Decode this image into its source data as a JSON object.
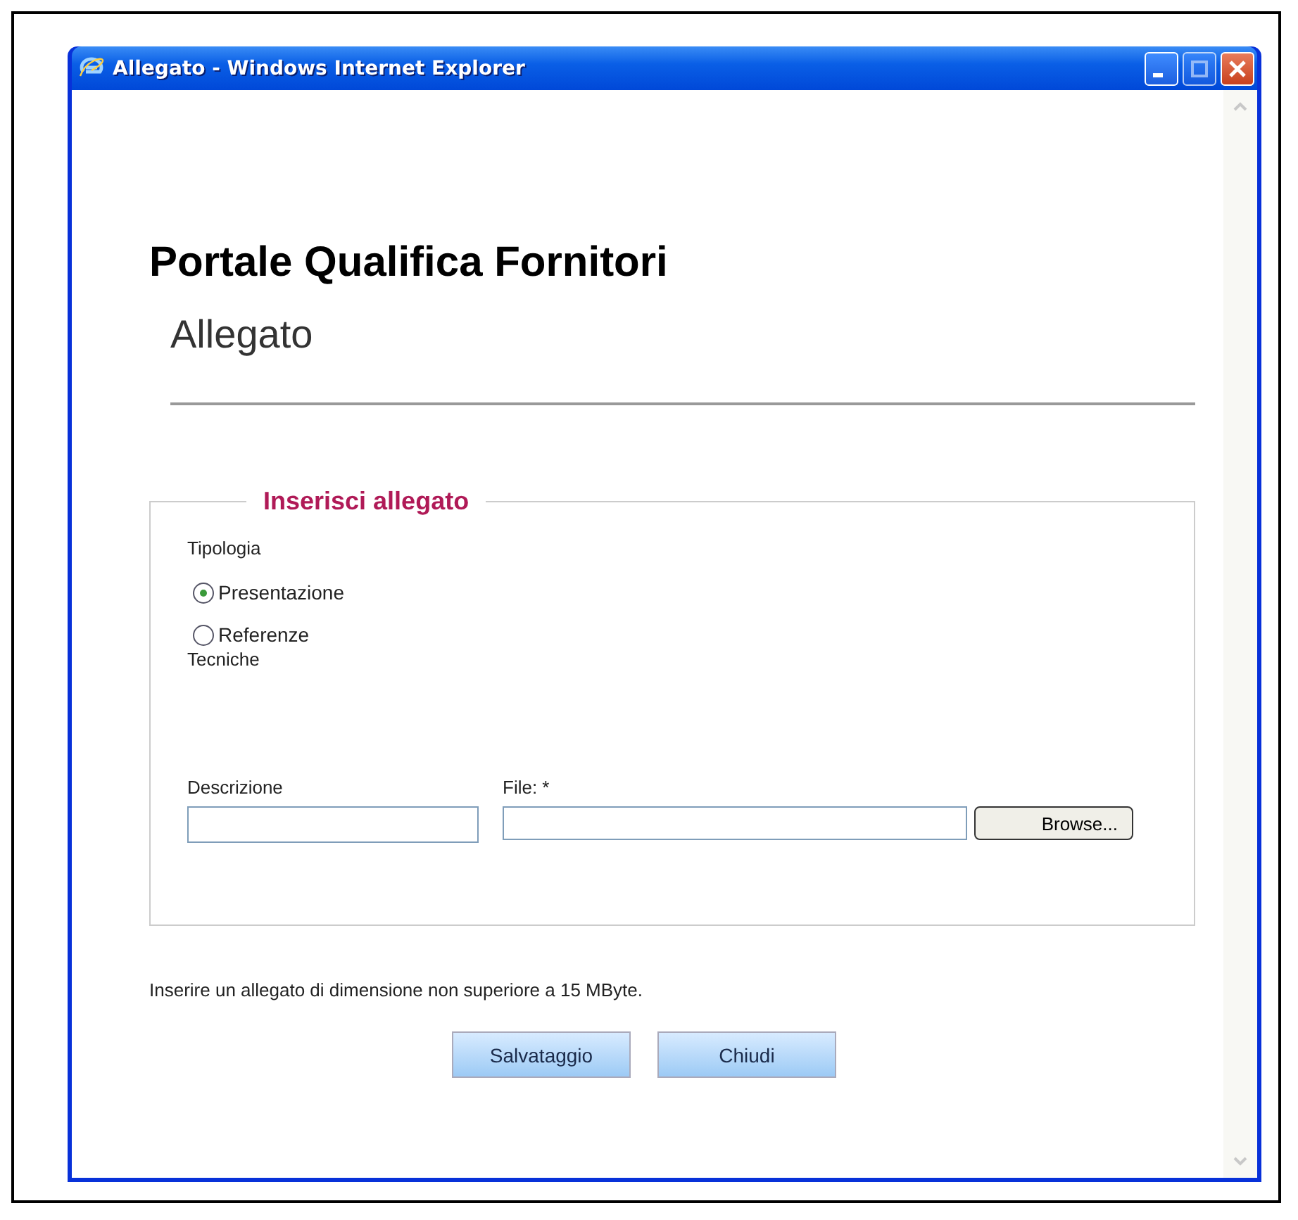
{
  "window": {
    "title": "Allegato - Windows Internet Explorer"
  },
  "page": {
    "heading": "Portale Qualifica Fornitori",
    "subheading": "Allegato"
  },
  "fieldset": {
    "legend": "Inserisci allegato",
    "type_label": "Tipologia",
    "options": [
      {
        "label": "Presentazione",
        "selected": true
      },
      {
        "label": "Referenze",
        "selected": false
      }
    ],
    "type_note": "Tecniche",
    "description_label": "Descrizione",
    "file_label": "File: *",
    "browse_button": "Browse..."
  },
  "note": "Inserire un allegato di dimensione non superiore a 15 MByte.",
  "buttons": [
    "Salvataggio",
    "Chiudi"
  ]
}
